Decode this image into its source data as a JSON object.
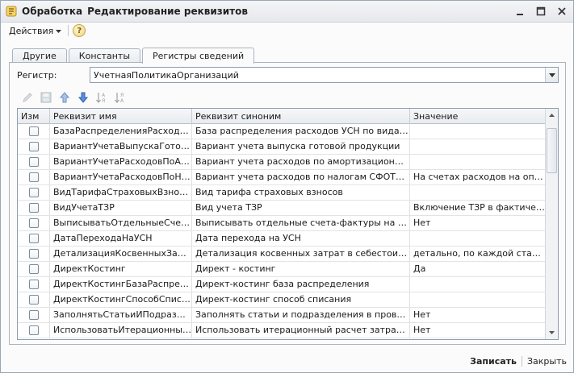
{
  "window": {
    "title_part1": "Обработка",
    "title_part2": "Редактирование реквизитов"
  },
  "menu": {
    "actions_label": "Действия",
    "help_label": "?"
  },
  "tabs": [
    {
      "label": "Другие",
      "active": false
    },
    {
      "label": "Константы",
      "active": false
    },
    {
      "label": "Регистры сведений",
      "active": true
    }
  ],
  "register": {
    "label": "Регистр:",
    "value": "УчетнаяПолитикаОрганизаций"
  },
  "toolbar_icons": [
    "edit-icon",
    "save-icon",
    "move-up-icon",
    "move-down-icon",
    "sort-asc-icon",
    "sort-desc-icon"
  ],
  "grid": {
    "columns": [
      "Изм",
      "Реквизит имя",
      "Реквизит синоним",
      "Значение"
    ],
    "rows": [
      {
        "changed": false,
        "name": "БазаРаспределенияРасходовУ...",
        "synonym": "База распределения расходов УСН по видам де...",
        "value": ""
      },
      {
        "changed": false,
        "name": "ВариантУчетаВыпускаГотовой...",
        "synonym": "Вариант учета выпуска готовой продукции",
        "value": ""
      },
      {
        "changed": false,
        "name": "ВариантУчетаРасходовПоАмо...",
        "synonym": "Вариант учета расходов по амортизационной пре...",
        "value": ""
      },
      {
        "changed": false,
        "name": "ВариантУчетаРасходовПоНало...",
        "synonym": "Вариант учета расходов по налогам СФОТВНало...",
        "value": "На счетах расходов на оплат..."
      },
      {
        "changed": false,
        "name": "ВидТарифаСтраховыхВзносов",
        "synonym": "Вид тарифа страховых взносов",
        "value": ""
      },
      {
        "changed": false,
        "name": "ВидУчетаТЗР",
        "synonym": "Вид учета ТЗР",
        "value": "Включение ТЗР в фактическу..."
      },
      {
        "changed": false,
        "name": "ВыписыватьОтдельныеСчета...",
        "synonym": "Выписывать отдельные счета-фактуры на суммо...",
        "value": "Нет"
      },
      {
        "changed": false,
        "name": "ДатаПереходаНаУСН",
        "synonym": "Дата перехода на УСН",
        "value": ""
      },
      {
        "changed": false,
        "name": "ДетализацияКосвенныхЗатрат...",
        "synonym": "Детализация косвенных затрат в себестоимости",
        "value": "детально, по каждой статье ..."
      },
      {
        "changed": false,
        "name": "ДиректКостинг",
        "synonym": "Директ - костинг",
        "value": "Да"
      },
      {
        "changed": false,
        "name": "ДиректКостингБазаРаспредел...",
        "synonym": "Директ-костинг база распределения",
        "value": ""
      },
      {
        "changed": false,
        "name": "ДиректКостингСпособСписания",
        "synonym": "Директ-костинг способ списания",
        "value": ""
      },
      {
        "changed": false,
        "name": "ЗаполнятьСтатьиИПодразделе...",
        "synonym": "Заполнять статьи и подразделения в проводках ...",
        "value": "Нет"
      },
      {
        "changed": false,
        "name": "ИспользоватьИтерационныйР...",
        "synonym": "Использовать итерационный расчет затрат встр...",
        "value": "Нет"
      }
    ]
  },
  "footer": {
    "save_label": "Записать",
    "close_label": "Закрыть"
  },
  "colors": {
    "frame_border": "#9aa7b4",
    "grid_border": "#8e9db0",
    "header_bg": "#e8ebef",
    "help_icon": "#f2d37a"
  }
}
